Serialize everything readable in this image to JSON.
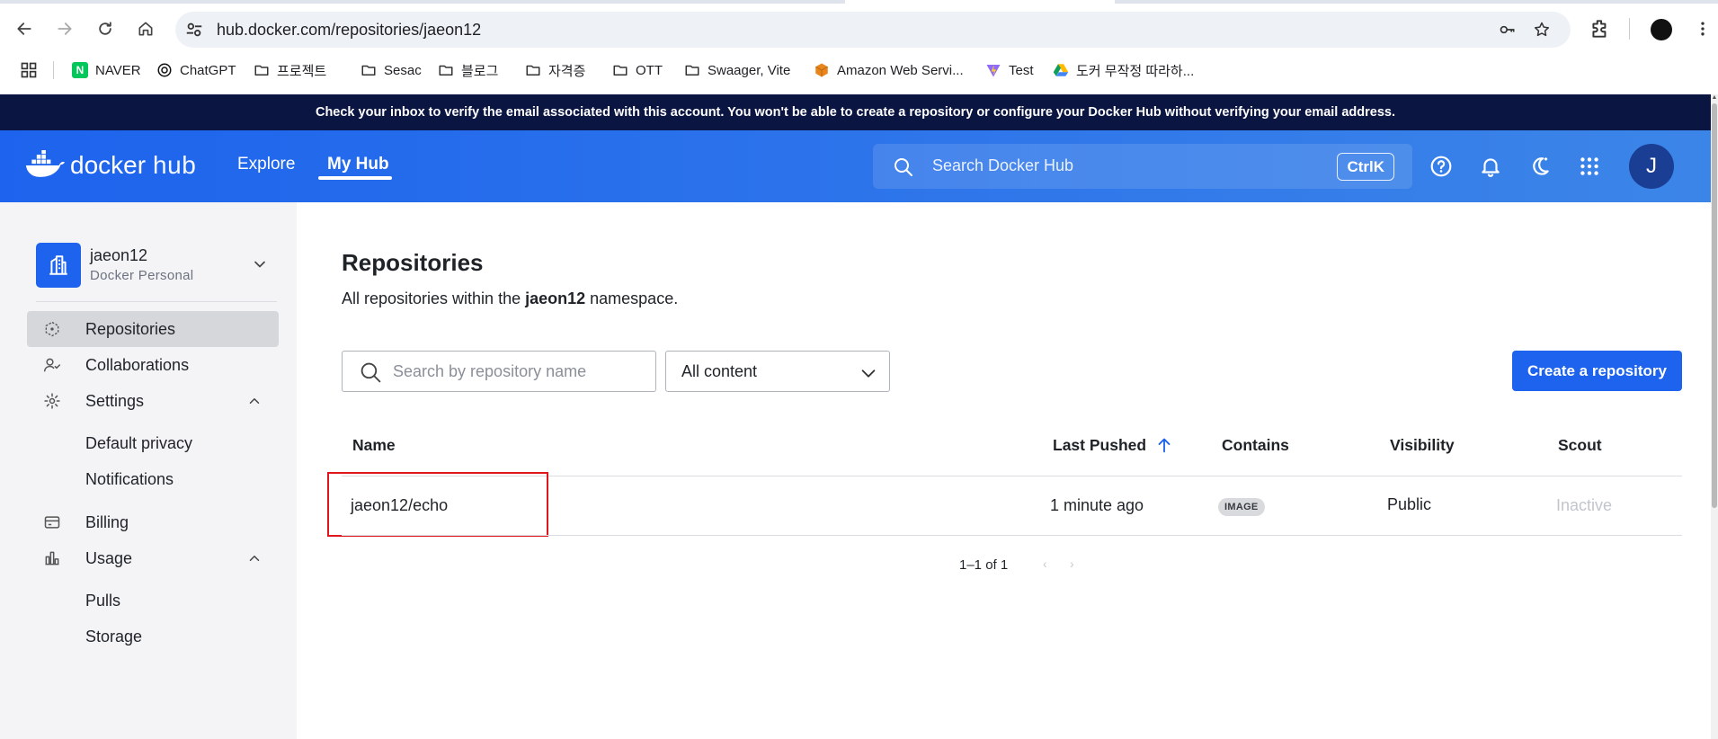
{
  "browser": {
    "url": "hub.docker.com/repositories/jaeon12",
    "bookmarks": [
      {
        "label": "NAVER",
        "icon": "naver-icon"
      },
      {
        "label": "ChatGPT",
        "icon": "chatgpt-icon"
      },
      {
        "label": "프로젝트",
        "icon": "folder-icon"
      },
      {
        "label": "Sesac",
        "icon": "folder-icon"
      },
      {
        "label": "블로그",
        "icon": "folder-icon"
      },
      {
        "label": "자격증",
        "icon": "folder-icon"
      },
      {
        "label": "OTT",
        "icon": "folder-icon"
      },
      {
        "label": "Swaager, Vite",
        "icon": "folder-icon"
      },
      {
        "label": "Amazon Web Servi...",
        "icon": "aws-icon"
      },
      {
        "label": "Test",
        "icon": "vite-icon"
      },
      {
        "label": "도커 무작정 따라하...",
        "icon": "google-drive-icon"
      }
    ]
  },
  "banner": {
    "text": "Check your inbox to verify the email associated with this account. You won't be able to create a repository or configure your Docker Hub without verifying your email address."
  },
  "header": {
    "logo_docker": "docker",
    "logo_hub": "hub",
    "nav_explore": "Explore",
    "nav_myhub": "My Hub",
    "search_placeholder": "Search Docker Hub",
    "shortcut": "CtrlK",
    "avatar_initial": "J",
    "brand_color": "#1d63ed"
  },
  "sidebar": {
    "account_name": "jaeon12",
    "account_type": "Docker Personal",
    "items": [
      {
        "label": "Repositories",
        "icon": "repositories-icon",
        "active": true
      },
      {
        "label": "Collaborations",
        "icon": "collaborations-icon"
      },
      {
        "label": "Settings",
        "icon": "gear-icon",
        "expanded": true
      },
      {
        "label": "Default privacy"
      },
      {
        "label": "Notifications"
      },
      {
        "label": "Billing",
        "icon": "billing-icon"
      },
      {
        "label": "Usage",
        "icon": "usage-icon",
        "expanded": true
      },
      {
        "label": "Pulls"
      },
      {
        "label": "Storage"
      }
    ]
  },
  "main": {
    "title": "Repositories",
    "subtitle_prefix": "All repositories within the ",
    "subtitle_namespace": "jaeon12",
    "subtitle_suffix": " namespace.",
    "search_placeholder": "Search by repository name",
    "content_filter": "All content",
    "create_button": "Create a repository",
    "table": {
      "columns": [
        "Name",
        "Last Pushed",
        "Contains",
        "Visibility",
        "Scout"
      ],
      "sort_column": "Last Pushed",
      "sort_direction": "ascending",
      "rows": [
        {
          "name": "jaeon12/echo",
          "last_pushed": "1 minute ago",
          "contains": "IMAGE",
          "visibility": "Public",
          "scout": "Inactive"
        }
      ]
    },
    "pagination": "1–1 of 1"
  }
}
